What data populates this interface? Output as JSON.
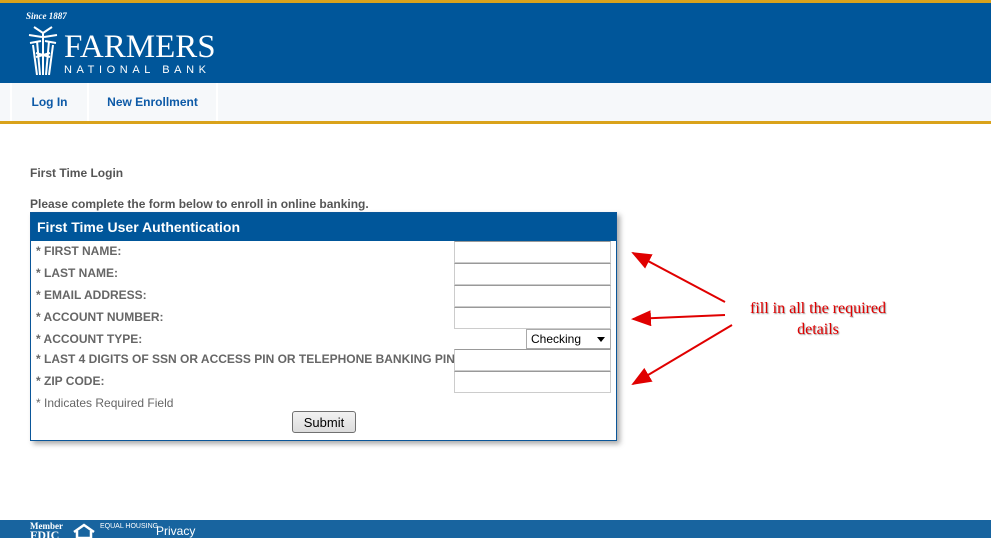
{
  "header": {
    "since": "Since 1887",
    "brand": "FARMERS",
    "brand_sub": "NATIONAL BANK",
    "colors": {
      "primary": "#00569a",
      "accent": "#d9a21b"
    }
  },
  "nav": {
    "tabs": [
      {
        "label": "Log In"
      },
      {
        "label": "New Enrollment"
      }
    ]
  },
  "main": {
    "title": "First Time Login",
    "intro": "Please complete the form below to enroll in online banking.",
    "panel_title": "First Time User Authentication",
    "fields": [
      {
        "label": "* FIRST NAME:",
        "value": ""
      },
      {
        "label": "* LAST NAME:",
        "value": ""
      },
      {
        "label": "* EMAIL ADDRESS:",
        "value": ""
      },
      {
        "label": "* ACCOUNT NUMBER:",
        "value": ""
      },
      {
        "label": "* ACCOUNT TYPE:",
        "value": "Checking"
      },
      {
        "label": "* LAST 4 DIGITS OF SSN OR ACCESS PIN OR TELEPHONE BANKING PIN:",
        "value": ""
      },
      {
        "label": "* ZIP CODE:",
        "value": ""
      }
    ],
    "required_note": "* Indicates Required Field",
    "submit_label": "Submit"
  },
  "annotation": {
    "text": "fill in all the required details",
    "color": "#e00000"
  },
  "footer": {
    "member": "Member",
    "fdic": "FDIC",
    "equal_housing": "EQUAL HOUSING",
    "privacy": "Privacy"
  }
}
